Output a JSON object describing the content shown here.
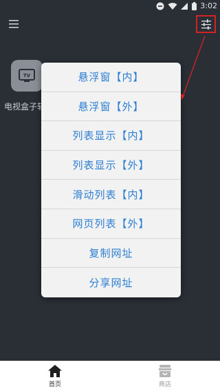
{
  "status_bar": {
    "time": "3:02",
    "icons": [
      "dnd-icon",
      "wifi-icon",
      "signal-icon",
      "battery-icon"
    ]
  },
  "app_bar": {
    "menu_icon": "hamburger-menu-icon",
    "filter_icon": "sliders-icon"
  },
  "home": {
    "app_tile": {
      "icon": "tv-icon",
      "label": "电视盒子软件"
    }
  },
  "popup_menu": {
    "items": [
      "悬浮窗【内】",
      "悬浮窗【外】",
      "列表显示【内】",
      "列表显示【外】",
      "滑动列表【内】",
      "网页列表【外】",
      "复制网址",
      "分享网址"
    ]
  },
  "bottom_nav": {
    "items": [
      {
        "label": "首页",
        "icon": "home-icon",
        "active": true
      },
      {
        "label": "商店",
        "icon": "store-icon",
        "active": false
      }
    ]
  },
  "colors": {
    "background": "#2a2f36",
    "menu_text": "#2d7fd3",
    "menu_bg": "#f2f2f2",
    "highlight": "#d62222"
  }
}
